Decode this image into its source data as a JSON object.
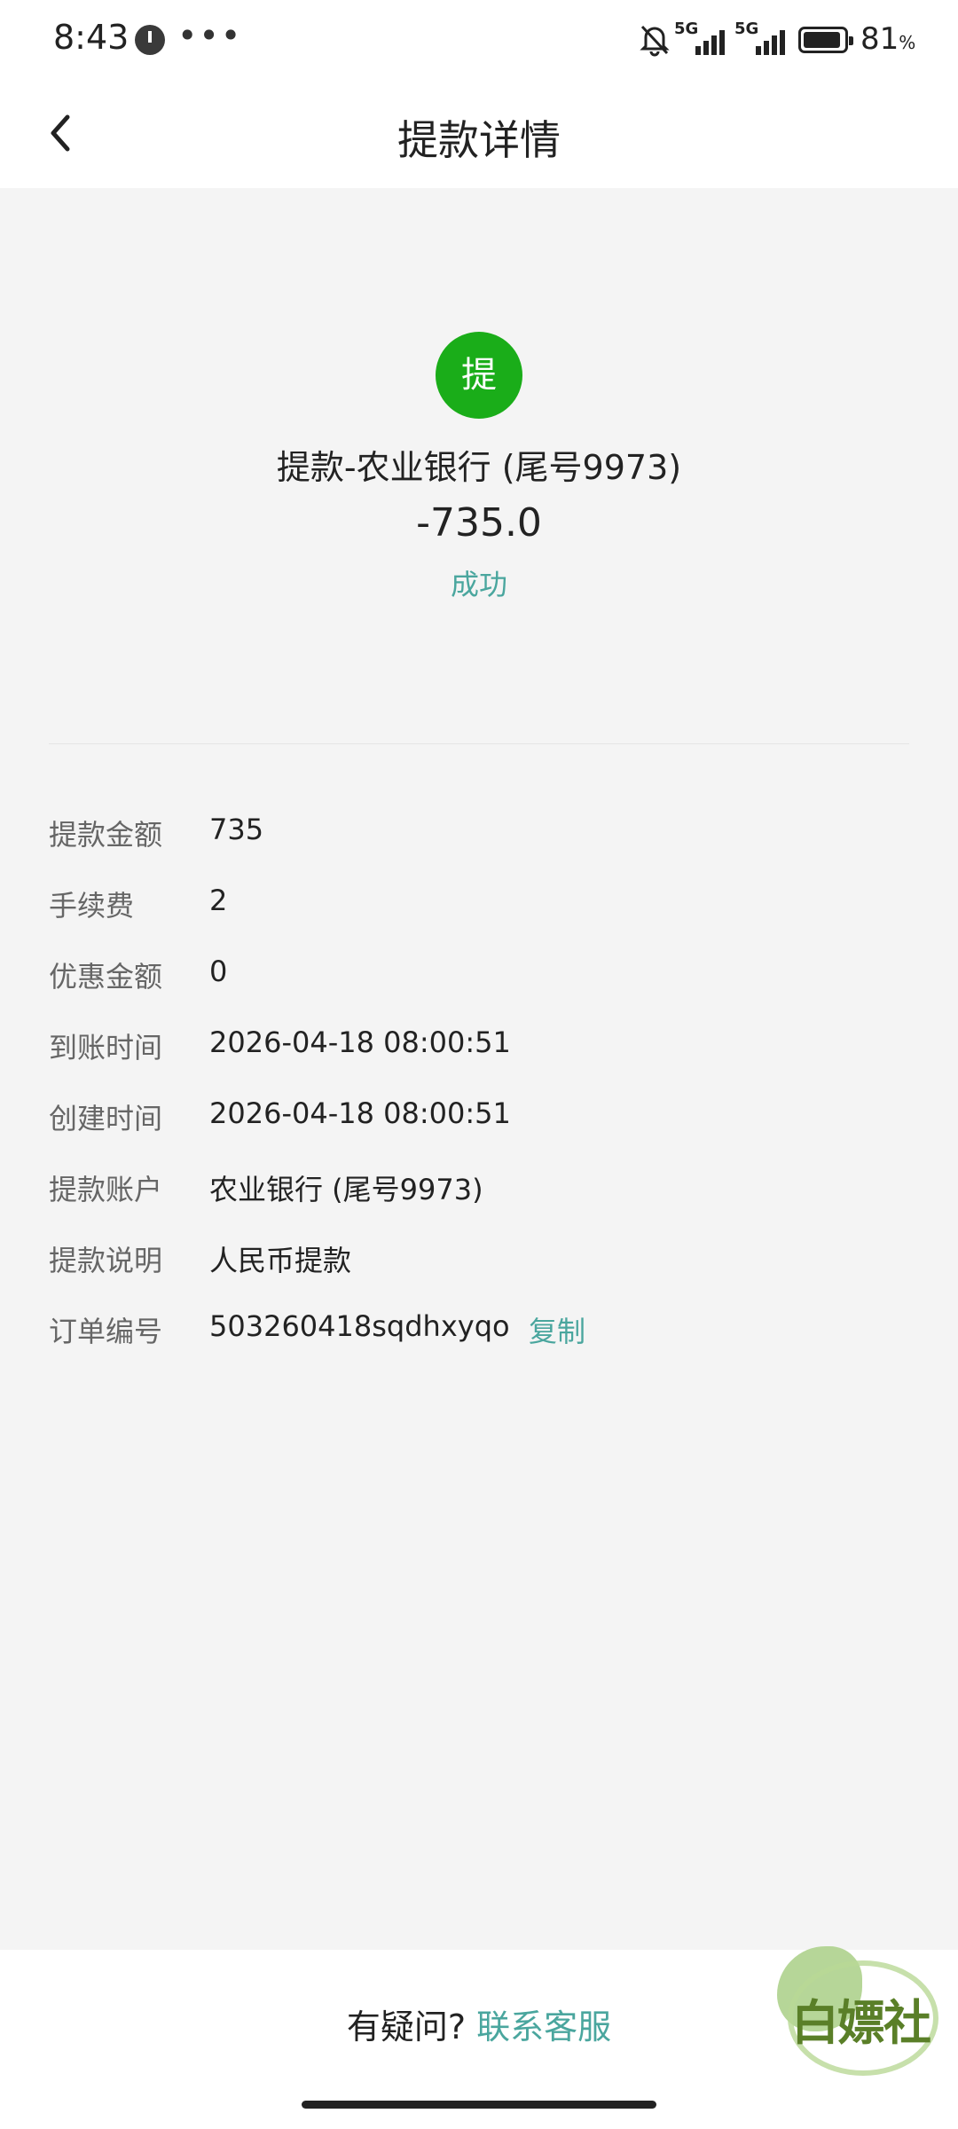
{
  "status_bar": {
    "time": "8:43",
    "more": "•••",
    "signal_1": "5G",
    "signal_2": "5G",
    "battery_percent": "81",
    "battery_unit": "%"
  },
  "nav": {
    "title": "提款详情",
    "back_icon": "chevron-left-icon"
  },
  "summary": {
    "badge": "提",
    "badge_color": "#1aad19",
    "title": "提款-农业银行 (尾号9973)",
    "amount": "-735.0",
    "status": "成功",
    "status_color": "#4aa69e"
  },
  "details": [
    {
      "label": "提款金额",
      "value": "735"
    },
    {
      "label": "手续费",
      "value": "2"
    },
    {
      "label": "优惠金额",
      "value": "0"
    },
    {
      "label": "到账时间",
      "value": "2026-04-18 08:00:51"
    },
    {
      "label": "创建时间",
      "value": "2026-04-18 08:00:51"
    },
    {
      "label": "提款账户",
      "value": "农业银行 (尾号9973)"
    },
    {
      "label": "提款说明",
      "value": "人民币提款"
    },
    {
      "label": "订单编号",
      "value": "503260418sqdhxyqo",
      "action": "复制"
    }
  ],
  "footer": {
    "question": "有疑问?",
    "contact": "联系客服",
    "link_color": "#4aa69e"
  },
  "watermark": {
    "text": "白嫖社"
  }
}
